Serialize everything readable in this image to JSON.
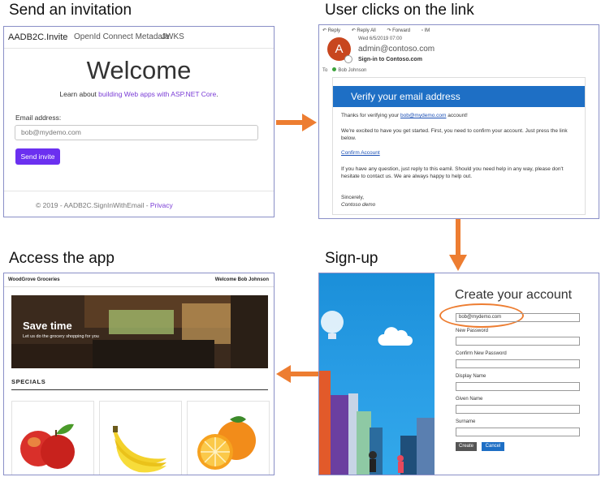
{
  "steps": {
    "step1": "Send an invitation",
    "step2": "User clicks on the link",
    "step3": "Sign-up",
    "step4": "Access the app"
  },
  "invite_app": {
    "brand": "AADB2C.Invite",
    "nav": [
      "OpenId Connect Metadata",
      "JWKS"
    ],
    "heading": "Welcome",
    "learn_prefix": "Learn about ",
    "learn_link": "building Web apps with ASP.NET Core",
    "learn_suffix": ".",
    "email_label": "Email address:",
    "email_placeholder": "bob@mydemo.com",
    "send_button": "Send invite",
    "footer_text": "© 2019 - AADB2C.SignInWithEmail - ",
    "footer_link": "Privacy"
  },
  "email": {
    "toolbar": [
      "Reply",
      "Reply All",
      "Forward",
      "IM"
    ],
    "avatar_letter": "A",
    "date": "Wed 6/5/2019 07:00",
    "from": "admin@contoso.com",
    "subject": "Sign-in to Contoso.com",
    "to_label": "To",
    "to_name": "Bob Johnson",
    "banner": "Verify your email address",
    "thanks_prefix": "Thanks for verifying your ",
    "thanks_email": "bob@mydemo.com",
    "thanks_suffix": " account!",
    "excited": "We're excited to have you get started. First, you need to confirm your account. Just press the link below.",
    "confirm_link": "Confirm Account",
    "question": "If you have any question, just reply to this eamil. Should you need help in any way, please don't hesitate to contact us. We are always happy to help out.",
    "sincerely": "Sincerely,",
    "signature": "Contoso demo"
  },
  "signup": {
    "heading": "Create your account",
    "email_value": "bob@mydemo.com",
    "fields": [
      "New Password",
      "Confirm New Password",
      "Display Name",
      "Given Name",
      "Surname"
    ],
    "create_button": "Create",
    "cancel_button": "Cancel"
  },
  "store": {
    "name": "WoodGrove Groceries",
    "welcome": "Welcome Bob Johnson",
    "hero_title": "Save time",
    "hero_subtitle": "Let us do the grocery shopping for you",
    "specials": "SPECIALS",
    "products": [
      "apple-image",
      "banana-image",
      "orange-image"
    ]
  },
  "colors": {
    "arrow": "#ed7d31",
    "accent_purple": "#6b30f0",
    "email_blue": "#1e6fc5",
    "panel_border": "#8a8fc7"
  }
}
